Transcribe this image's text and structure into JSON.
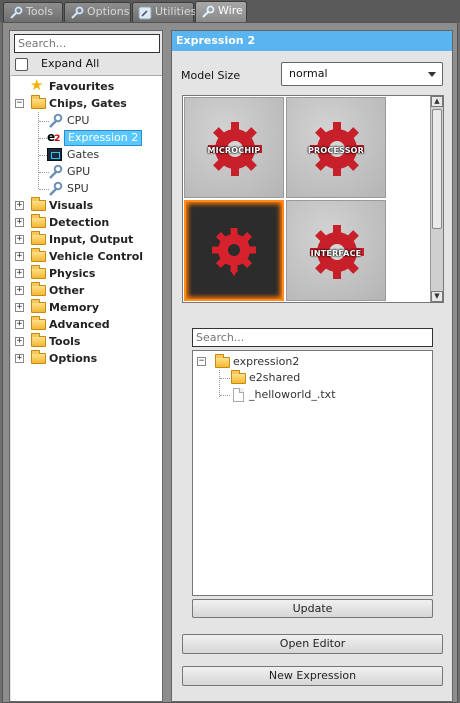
{
  "tabs": [
    {
      "label": "Tools",
      "icon": "wrench-icon"
    },
    {
      "label": "Options",
      "icon": "wrench-icon"
    },
    {
      "label": "Utilities",
      "icon": "utilities-icon"
    },
    {
      "label": "Wire",
      "icon": "wrench-icon",
      "active": true
    }
  ],
  "left": {
    "search_placeholder": "Search...",
    "expand_all_label": "Expand All",
    "tree": [
      {
        "label": "Favourites",
        "icon": "star-icon"
      },
      {
        "label": "Chips, Gates",
        "icon": "folder-icon",
        "expanded": true,
        "children": [
          {
            "label": "CPU",
            "icon": "wrench-icon"
          },
          {
            "label": "Expression 2",
            "icon": "e2-icon",
            "selected": true
          },
          {
            "label": "Gates",
            "icon": "gates-icon"
          },
          {
            "label": "GPU",
            "icon": "wrench-icon"
          },
          {
            "label": "SPU",
            "icon": "wrench-icon"
          }
        ]
      },
      {
        "label": "Visuals",
        "icon": "folder-icon"
      },
      {
        "label": "Detection",
        "icon": "folder-icon"
      },
      {
        "label": "Input, Output",
        "icon": "folder-icon"
      },
      {
        "label": "Vehicle Control",
        "icon": "folder-icon"
      },
      {
        "label": "Physics",
        "icon": "folder-icon"
      },
      {
        "label": "Other",
        "icon": "folder-icon"
      },
      {
        "label": "Memory",
        "icon": "folder-icon"
      },
      {
        "label": "Advanced",
        "icon": "folder-icon"
      },
      {
        "label": "Tools",
        "icon": "folder-icon"
      },
      {
        "label": "Options",
        "icon": "folder-icon"
      }
    ]
  },
  "right": {
    "title": "Expression 2",
    "model_size_label": "Model Size",
    "model_size_value": "normal",
    "models": [
      {
        "label": "MICROCHIP",
        "selected": false
      },
      {
        "label": "PROCESSOR",
        "selected": false
      },
      {
        "label": "",
        "selected": true
      },
      {
        "label": "INTERFACE",
        "selected": false
      }
    ],
    "file_search_placeholder": "Search...",
    "files": {
      "root": "expression2",
      "children": [
        {
          "label": "e2shared",
          "type": "folder"
        },
        {
          "label": "_helloworld_.txt",
          "type": "file"
        }
      ]
    },
    "update_label": "Update",
    "open_editor_label": "Open Editor",
    "new_expression_label": "New Expression"
  },
  "colors": {
    "title_bar": "#5ab4f0",
    "selected_item": "#5ac8ff",
    "model_glow": "#ff8a1e",
    "gear_red": "#c8202a"
  }
}
